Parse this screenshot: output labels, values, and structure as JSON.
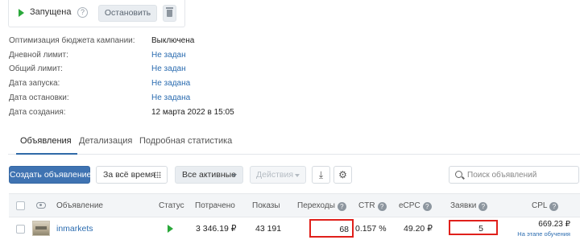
{
  "status": {
    "label": "Запущена",
    "help": "?",
    "stop_label": "Остановить"
  },
  "info": [
    {
      "label": "Оптимизация бюджета кампании:",
      "value": "Выключена",
      "link": false
    },
    {
      "label": "Дневной лимит:",
      "value": "Не задан",
      "link": true
    },
    {
      "label": "Общий лимит:",
      "value": "Не задан",
      "link": true
    },
    {
      "label": "Дата запуска:",
      "value": "Не задана",
      "link": true
    },
    {
      "label": "Дата остановки:",
      "value": "Не задана",
      "link": true
    },
    {
      "label": "Дата создания:",
      "value": "12 марта 2022 в 15:05",
      "link": false
    }
  ],
  "tabs": [
    {
      "label": "Объявления",
      "active": true
    },
    {
      "label": "Детализация",
      "active": false
    },
    {
      "label": "Подробная статистика",
      "active": false
    }
  ],
  "toolbar": {
    "create_label": "Создать объявление",
    "period_label": "За всё время",
    "filter_label": "Все активные",
    "actions_label": "Действия"
  },
  "search": {
    "placeholder": "Поиск объявлений"
  },
  "table": {
    "columns": {
      "ad": "Объявление",
      "status": "Статус",
      "spent": "Потрачено",
      "impressions": "Показы",
      "clicks": "Переходы",
      "ctr": "CTR",
      "ecpc": "eCPC",
      "leads": "Заявки",
      "cpl": "CPL"
    },
    "rows": [
      {
        "name": "inmarkets",
        "status": "running",
        "spent": "3 346.19 ₽",
        "impressions": "43 191",
        "clicks": "68",
        "ctr": "0.157 %",
        "ecpc": "49.20 ₽",
        "leads": "5",
        "cpl": "669.23 ₽",
        "cpl_note": "На этапе обучения"
      }
    ]
  },
  "colors": {
    "accent": "#3f73b2",
    "link": "#2b6cb0",
    "running": "#2aa83a",
    "highlight": "#e0201b"
  },
  "icons": {
    "status": "play-icon",
    "help": "question-circle-icon",
    "delete": "trash-icon",
    "columns": "grid-icon",
    "download": "download-icon",
    "settings": "gear-icon",
    "search": "search-icon",
    "visibility": "eye-icon"
  }
}
